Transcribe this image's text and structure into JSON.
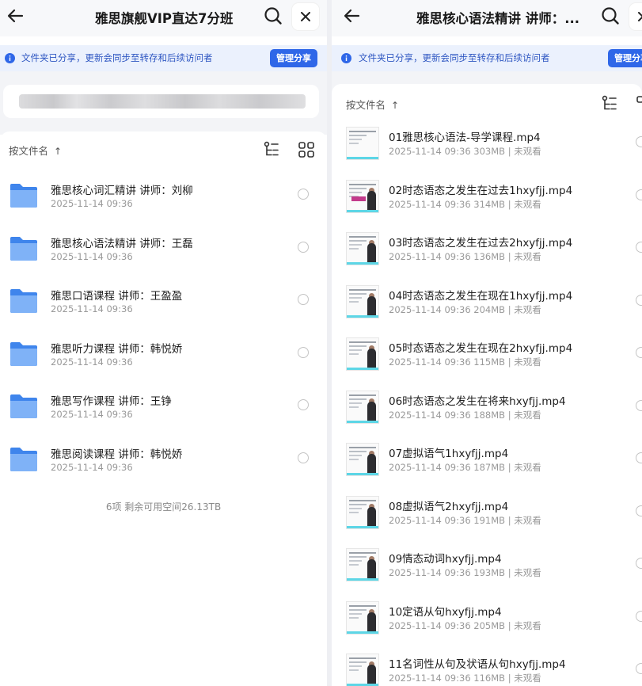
{
  "left": {
    "title": "雅思旗舰VIP直达7分班",
    "banner_text": "文件夹已分享，更新会同步至转存和后续访问者",
    "manage_label": "管理分享",
    "sort_label": "按文件名",
    "folders": [
      {
        "name": "雅思核心词汇精讲 讲师：刘柳",
        "date": "2025-11-14 09:36"
      },
      {
        "name": "雅思核心语法精讲  讲师：王磊",
        "date": "2025-11-14 09:36"
      },
      {
        "name": "雅思口语课程 讲师：王盈盈",
        "date": "2025-11-14 09:36"
      },
      {
        "name": "雅思听力课程  讲师：韩悦娇",
        "date": "2025-11-14 09:36"
      },
      {
        "name": "雅思写作课程 讲师：王铮",
        "date": "2025-11-14 09:36"
      },
      {
        "name": "雅思阅读课程 讲师：韩悦娇",
        "date": "2025-11-14 09:36"
      }
    ],
    "footer": "6项  剩余可用空间26.13TB"
  },
  "right": {
    "title": "雅思核心语法精讲  讲师：...",
    "banner_text": "文件夹已分享，更新会同步至转存和后续访问者",
    "manage_label": "管理分享",
    "sort_label": "按文件名",
    "files": [
      {
        "name": "01雅思核心语法-导学课程.mp4",
        "meta": "2025-11-14 09:36  303MB | 未观看"
      },
      {
        "name": "02时态语态之发生在过去1hxyfjj.mp4",
        "meta": "2025-11-14 09:36  314MB | 未观看"
      },
      {
        "name": "03时态语态之发生在过去2hxyfjj.mp4",
        "meta": "2025-11-14 09:36  136MB | 未观看"
      },
      {
        "name": "04时态语态之发生在现在1hxyfjj.mp4",
        "meta": "2025-11-14 09:36  204MB | 未观看"
      },
      {
        "name": "05时态语态之发生在现在2hxyfjj.mp4",
        "meta": "2025-11-14 09:36  115MB | 未观看"
      },
      {
        "name": "06时态语态之发生在将来hxyfjj.mp4",
        "meta": "2025-11-14 09:36  188MB | 未观看"
      },
      {
        "name": "07虚拟语气1hxyfjj.mp4",
        "meta": "2025-11-14 09:36  187MB | 未观看"
      },
      {
        "name": "08虚拟语气2hxyfjj.mp4",
        "meta": "2025-11-14 09:36  191MB | 未观看"
      },
      {
        "name": "09情态动词hxyfjj.mp4",
        "meta": "2025-11-14 09:36  193MB | 未观看"
      },
      {
        "name": "10定语从句hxyfjj.mp4",
        "meta": "2025-11-14 09:36  205MB | 未观看"
      },
      {
        "name": "11名词性从句及状语从句hxyfjj.mp4",
        "meta": "2025-11-14 09:36  116MB | 未观看"
      }
    ]
  },
  "icons": {
    "back": "back-arrow-icon",
    "search": "search-icon",
    "close": "close-icon",
    "info": "info-icon",
    "tree": "tree-view-icon",
    "grid": "grid-view-icon",
    "folder": "folder-icon",
    "video": "video-thumbnail"
  },
  "colors": {
    "accent": "#2f67e8",
    "banner_bg": "#ebf1fd",
    "banner_text": "#2f57c2",
    "folder": "#4a8ff0"
  }
}
